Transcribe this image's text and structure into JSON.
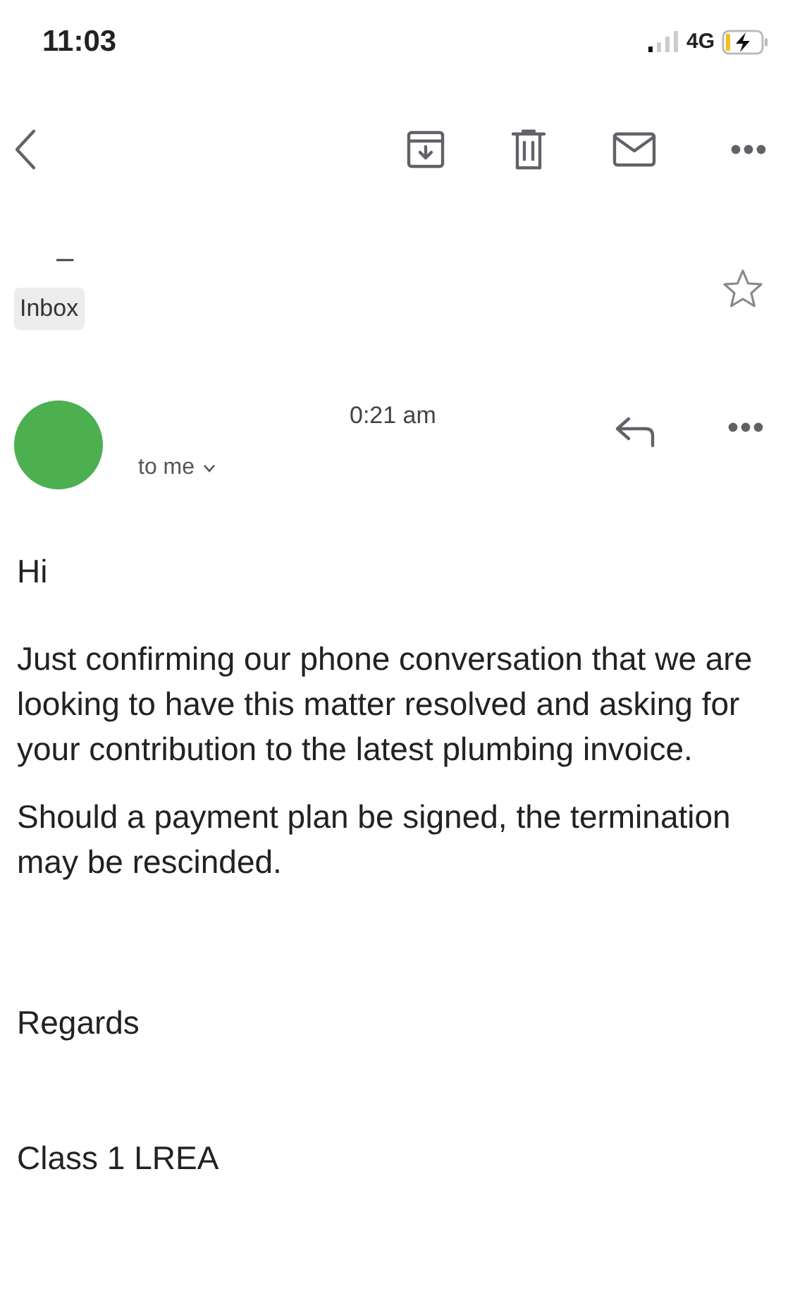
{
  "status_bar": {
    "time": "11:03",
    "network": "4G"
  },
  "subject": "–",
  "label": "Inbox",
  "starred": false,
  "message": {
    "time": "0:21 am",
    "recipient": "to me"
  },
  "body": {
    "greeting": "Hi",
    "paragraphs": [
      "Just confirming our phone conversation that we are looking to have this matter resolved and asking for your contribution to the latest plumbing invoice.",
      "Should a payment plan be signed, the termination may be rescinded."
    ],
    "closing": "Regards",
    "signature": "Class 1 LREA"
  }
}
